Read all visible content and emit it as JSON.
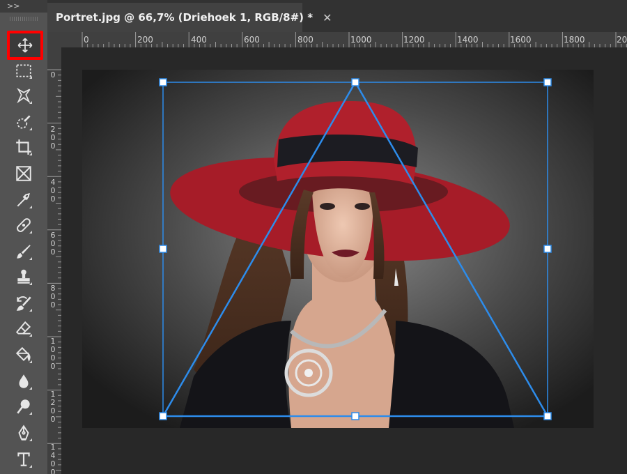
{
  "toolbar": {
    "collapse_label": ">>",
    "tools": [
      {
        "name": "move-tool",
        "icon": "move-icon",
        "selected": true
      },
      {
        "name": "rectangular-marquee-tool",
        "icon": "marquee-icon"
      },
      {
        "name": "lasso-tool",
        "icon": "lasso-icon"
      },
      {
        "name": "quick-selection-tool",
        "icon": "quick-selection-icon"
      },
      {
        "name": "crop-tool",
        "icon": "crop-icon"
      },
      {
        "name": "frame-tool",
        "icon": "frame-icon"
      },
      {
        "name": "eyedropper-tool",
        "icon": "eyedropper-icon"
      },
      {
        "name": "healing-brush-tool",
        "icon": "bandage-icon"
      },
      {
        "name": "brush-tool",
        "icon": "brush-icon"
      },
      {
        "name": "clone-stamp-tool",
        "icon": "stamp-icon"
      },
      {
        "name": "history-brush-tool",
        "icon": "history-brush-icon"
      },
      {
        "name": "eraser-tool",
        "icon": "eraser-icon"
      },
      {
        "name": "paint-bucket-tool",
        "icon": "paint-bucket-icon"
      },
      {
        "name": "blur-tool",
        "icon": "drop-icon"
      },
      {
        "name": "dodge-tool",
        "icon": "dodge-icon"
      },
      {
        "name": "pen-tool",
        "icon": "pen-icon"
      },
      {
        "name": "type-tool",
        "icon": "type-icon"
      }
    ]
  },
  "document": {
    "tab_title": "Portret.jpg @ 66,7% (Driehoek 1, RGB/8#) *",
    "close_symbol": "✕"
  },
  "rulers": {
    "horizontal": [
      "0",
      "200",
      "400",
      "600",
      "800",
      "1000",
      "1200",
      "1400",
      "1600",
      "1800",
      "20"
    ],
    "vertical": [
      "0",
      "200",
      "400",
      "600",
      "800",
      "1000",
      "1200",
      "1400"
    ]
  },
  "colors": {
    "highlight": "#ff0000",
    "selection": "#2d8ceb",
    "hat_red": "#b01e2a"
  }
}
